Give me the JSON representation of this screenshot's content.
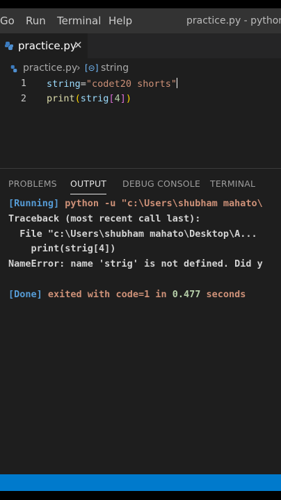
{
  "menu": {
    "items": [
      "Go",
      "Run",
      "Terminal",
      "Help"
    ],
    "window_title": "practice.py - python -"
  },
  "tab": {
    "icon": "python-file-icon",
    "filename": "practice.py",
    "close_glyph": "✕"
  },
  "breadcrumb": {
    "file": "practice.py",
    "separator": "›",
    "symbol_icon": "[⊝]",
    "symbol": "string"
  },
  "editor": {
    "lines": [
      {
        "number": "1",
        "var": "string",
        "op": "=",
        "str": "\"codet20 shorts\""
      },
      {
        "number": "2",
        "fn": "print",
        "open": "(",
        "arg": "strig",
        "bopen": "[",
        "index": "4",
        "bclose": "]",
        "close": ")"
      }
    ]
  },
  "panel": {
    "tabs": [
      "PROBLEMS",
      "OUTPUT",
      "DEBUG CONSOLE",
      "TERMINAL"
    ],
    "active_tab": "OUTPUT"
  },
  "output": {
    "running_tag": "[Running]",
    "running_cmd": " python -u \"c:\\Users\\shubham mahato\\",
    "traceback": "Traceback (most recent call last):",
    "file_line": "  File \"c:\\Users\\shubham mahato\\Desktop\\A...",
    "code_line": "    print(strig[4])",
    "error": "NameError: name 'strig' is not defined. Did y",
    "done_tag": "[Done]",
    "done_exit": " exited with ",
    "done_code": "code=1",
    "done_in": " in ",
    "done_time": "0.477",
    "done_seconds": " seconds"
  },
  "colors": {
    "statusbar": "#007acc",
    "running_tag": "#569cd6",
    "done_text": "#ce9178"
  }
}
